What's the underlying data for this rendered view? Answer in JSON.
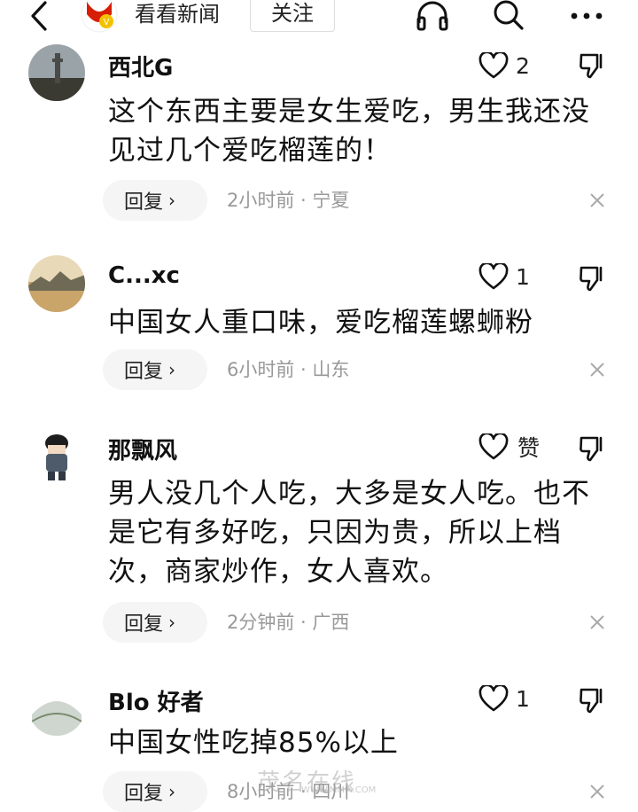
{
  "header": {
    "app_name": "看看新闻",
    "follow_label": "关注",
    "icons": [
      "back-arrow-icon",
      "headphones-icon",
      "search-icon",
      "more-icon"
    ],
    "brand_color": "#d81e06"
  },
  "comments": [
    {
      "username": "西北G",
      "likes": "2",
      "text": "这个东西主要是女生爱吃，男生我还没见过几个爱吃榴莲的！",
      "reply_label": "回复",
      "meta": "2小时前 · 宁夏"
    },
    {
      "username": "C...xc",
      "likes": "1",
      "text": "中国女人重口味，爱吃榴莲螺蛳粉",
      "reply_label": "回复",
      "meta": "6小时前 · 山东"
    },
    {
      "username": "那飘风",
      "likes": "赞",
      "text": "男人没几个人吃，大多是女人吃。也不是它有多好吃，只因为贵，所以上档次，商家炒作，女人喜欢。",
      "reply_label": "回复",
      "meta": "2分钟前 · 广西"
    },
    {
      "username": "Blo 好者",
      "likes": "1",
      "text": "中国女性吃掉85%以上",
      "reply_label": "回复",
      "meta": "8小时前 · 四川"
    }
  ],
  "watermark": "茂名在线",
  "watermark_url": "WWW.MMM.COM"
}
